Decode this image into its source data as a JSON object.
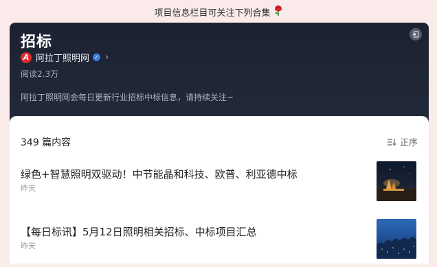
{
  "banner": {
    "text": "项目信息栏目可关注下列合集",
    "icon": "rose-icon"
  },
  "header": {
    "title": "招标",
    "author": "阿拉丁照明网",
    "reads": "阅读2.3万",
    "description": "阿拉丁照明网会每日更新行业招标中标信息，请持续关注~"
  },
  "content": {
    "count": "349 篇内容",
    "sort_label": "正序",
    "articles": [
      {
        "title": "绿色+智慧照明双驱动！中节能晶和科技、欧普、利亚德中标",
        "time": "昨天"
      },
      {
        "title": "【每日标讯】5月12日照明相关招标、中标项目汇总",
        "time": "昨天"
      }
    ]
  },
  "colors": {
    "header_bg": "#1c2230",
    "page_bg": "#fbeaea",
    "brand_red": "#e12a2f",
    "verified_blue": "#3d7ee8"
  }
}
